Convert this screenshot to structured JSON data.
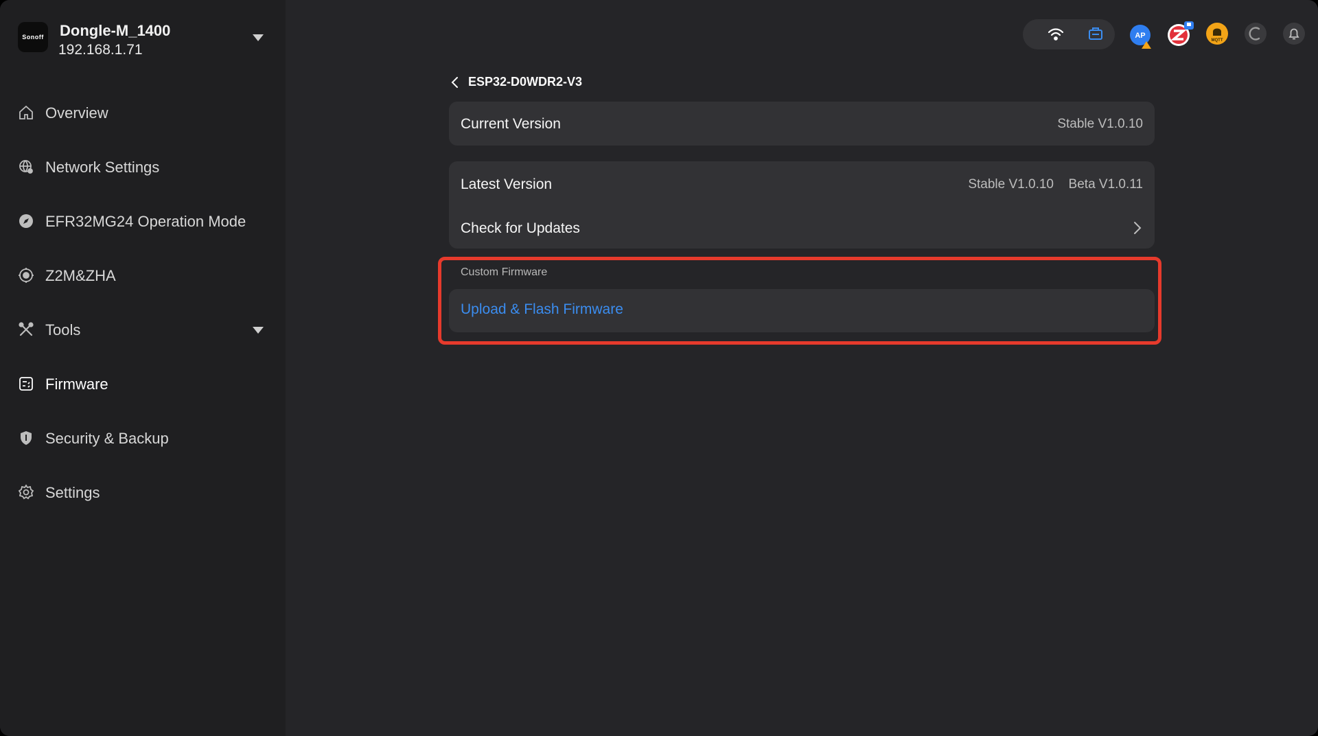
{
  "sidebar": {
    "logo_text": "Sonoff",
    "device_name": "Dongle-M_1400",
    "device_ip": "192.168.1.71",
    "items": [
      {
        "label": "Overview",
        "icon": "home-icon"
      },
      {
        "label": "Network Settings",
        "icon": "network-globe-icon"
      },
      {
        "label": "EFR32MG24 Operation Mode",
        "icon": "compass-icon"
      },
      {
        "label": "Z2M&ZHA",
        "icon": "zigbee-target-icon"
      },
      {
        "label": "Tools",
        "icon": "tools-icon"
      },
      {
        "label": "Firmware",
        "icon": "firmware-chip-icon",
        "active": true
      },
      {
        "label": "Security & Backup",
        "icon": "shield-icon"
      },
      {
        "label": "Settings",
        "icon": "gear-icon"
      }
    ]
  },
  "topbar": {
    "icons": [
      "wifi-icon",
      "ethernet-icon",
      "ap-warning-icon",
      "zigbee2mqtt-icon",
      "mqtt-icon",
      "refresh-icon",
      "bell-icon"
    ],
    "badge_text": "AP",
    "mqtt_badge": "MQTT"
  },
  "main": {
    "back_label": "ESP32-D0WDR2-V3",
    "current_version_label": "Current Version",
    "current_version_value": "Stable V1.0.10",
    "latest_version_label": "Latest Version",
    "latest_stable": "Stable V1.0.10",
    "latest_beta": "Beta V1.0.11",
    "check_updates_label": "Check for Updates",
    "custom_section_label": "Custom Firmware",
    "upload_flash_label": "Upload & Flash Firmware"
  },
  "colors": {
    "sidebar_bg": "#1f1f21",
    "main_bg": "#252528",
    "card_bg": "#323235",
    "accent_link": "#3b8df0",
    "highlight_border": "#e63a2c"
  }
}
